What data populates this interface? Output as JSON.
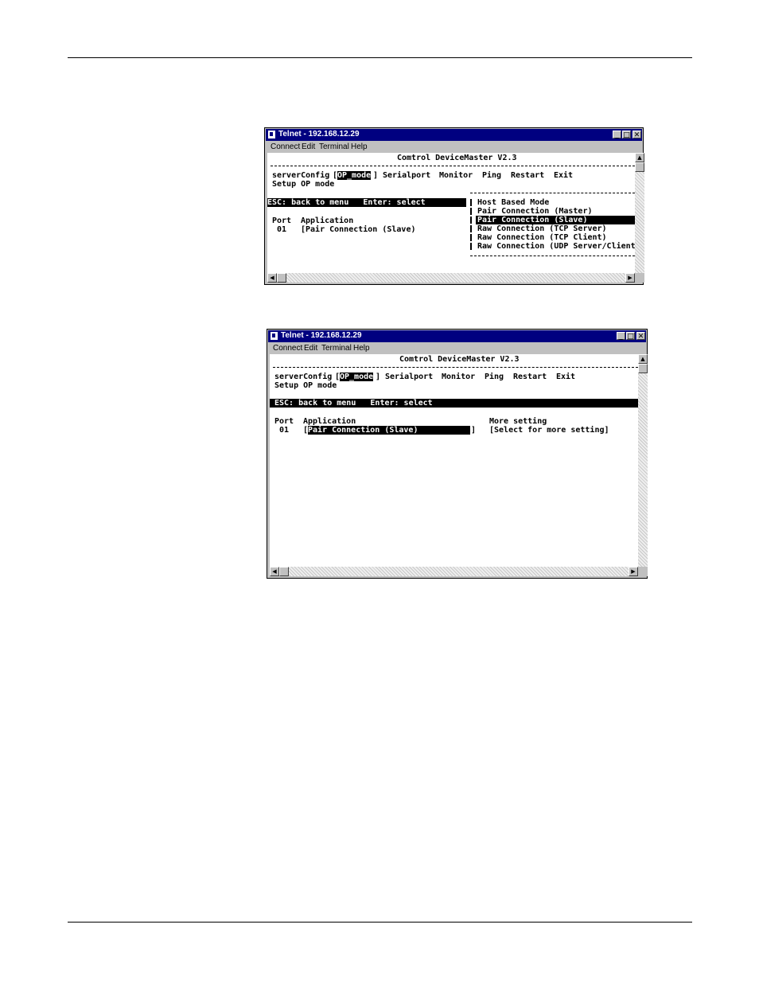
{
  "window_title": "Telnet - 192.168.12.29",
  "window_buttons": {
    "minimize": "_",
    "maximize": "□",
    "close": "✕"
  },
  "menu": [
    "Connect",
    "Edit",
    "Terminal",
    "Help"
  ],
  "terminal": {
    "header": "Comtrol DeviceMaster V2.3",
    "nav": {
      "items": [
        "serverConfig",
        "OP_mode",
        "Serialport",
        "Monitor",
        "Ping",
        "Restart",
        "Exit"
      ],
      "selected": "OP_mode"
    },
    "subtitle": "Setup OP mode",
    "status_bar": "ESC: back to menu   Enter: select",
    "columns": {
      "port": "Port",
      "application": "Application",
      "more_setting": "More setting"
    },
    "row": {
      "port": "01",
      "application": "Pair Connection (Slave)",
      "more_setting": "[Select for more setting]"
    }
  },
  "screen1": {
    "row_application_text": "[Pair Connection (Slave)",
    "dropdown_options": [
      "Host Based Mode",
      "Pair Connection (Master)",
      "Pair Connection (Slave)",
      "Raw Connection (TCP Server)",
      "Raw Connection (TCP Client)",
      "Raw Connection (UDP Server/Client"
    ],
    "dropdown_selected_index": 2
  },
  "icons": {
    "telnet": "telnet-app-icon",
    "scroll_up": "arrow-up-icon",
    "scroll_left": "arrow-left-icon",
    "scroll_right": "arrow-right-icon"
  }
}
